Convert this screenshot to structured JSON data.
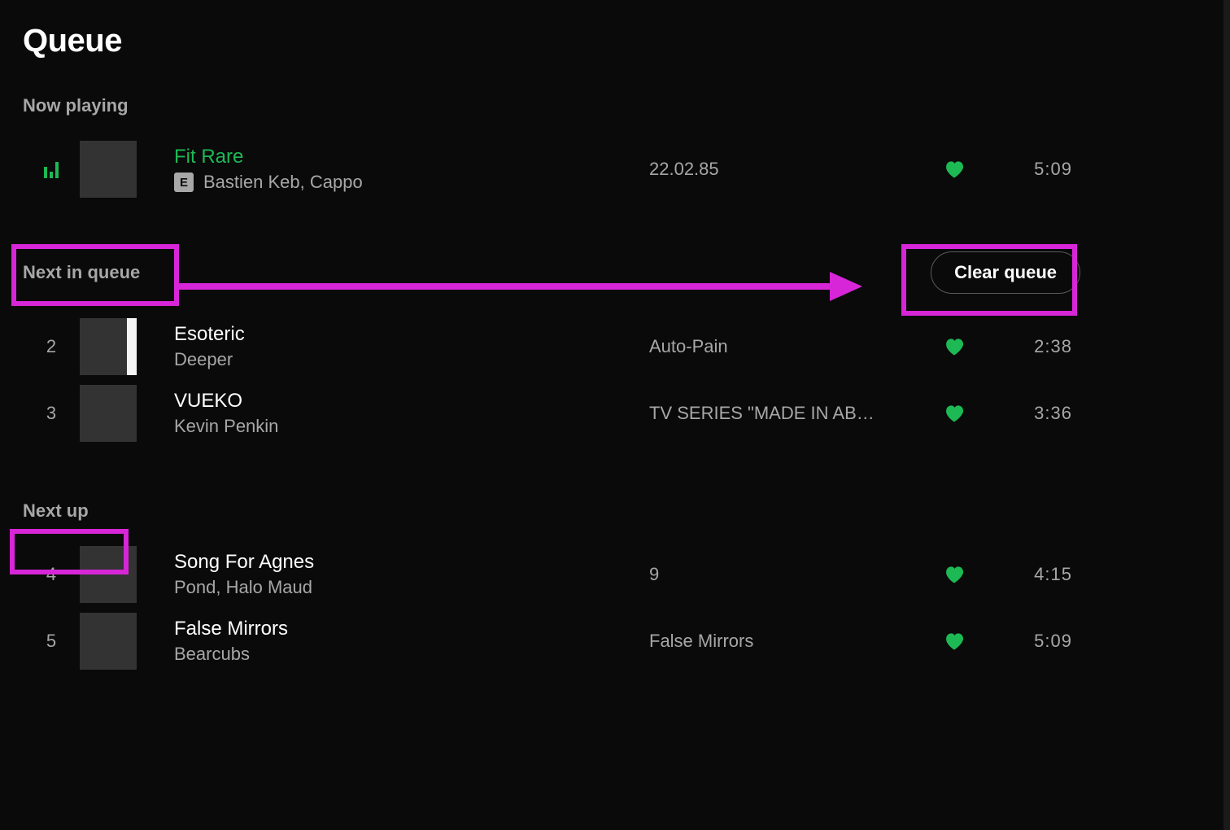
{
  "page": {
    "title": "Queue"
  },
  "sections": {
    "now_playing_label": "Now playing",
    "next_in_queue_label": "Next in queue",
    "next_up_label": "Next up",
    "clear_button_label": "Clear queue"
  },
  "now_playing": {
    "title": "Fit Rare",
    "artists": "Bastien Keb, Cappo",
    "explicit_badge": "E",
    "album": "22.02.85",
    "duration": "5:09",
    "liked": true
  },
  "next_in_queue": [
    {
      "index": "2",
      "title": "Esoteric",
      "artists": "Deeper",
      "album": "Auto-Pain",
      "duration": "2:38",
      "liked": true
    },
    {
      "index": "3",
      "title": "VUEKO",
      "artists": "Kevin Penkin",
      "album": "TV SERIES \"MADE IN AB…",
      "duration": "3:36",
      "liked": true
    }
  ],
  "next_up": [
    {
      "index": "4",
      "title": "Song For Agnes",
      "artists": "Pond, Halo Maud",
      "album": "9",
      "duration": "4:15",
      "liked": true
    },
    {
      "index": "5",
      "title": "False Mirrors",
      "artists": "Bearcubs",
      "album": "False Mirrors",
      "duration": "5:09",
      "liked": true
    }
  ],
  "annotations": {
    "highlight_color": "#d726d7"
  }
}
